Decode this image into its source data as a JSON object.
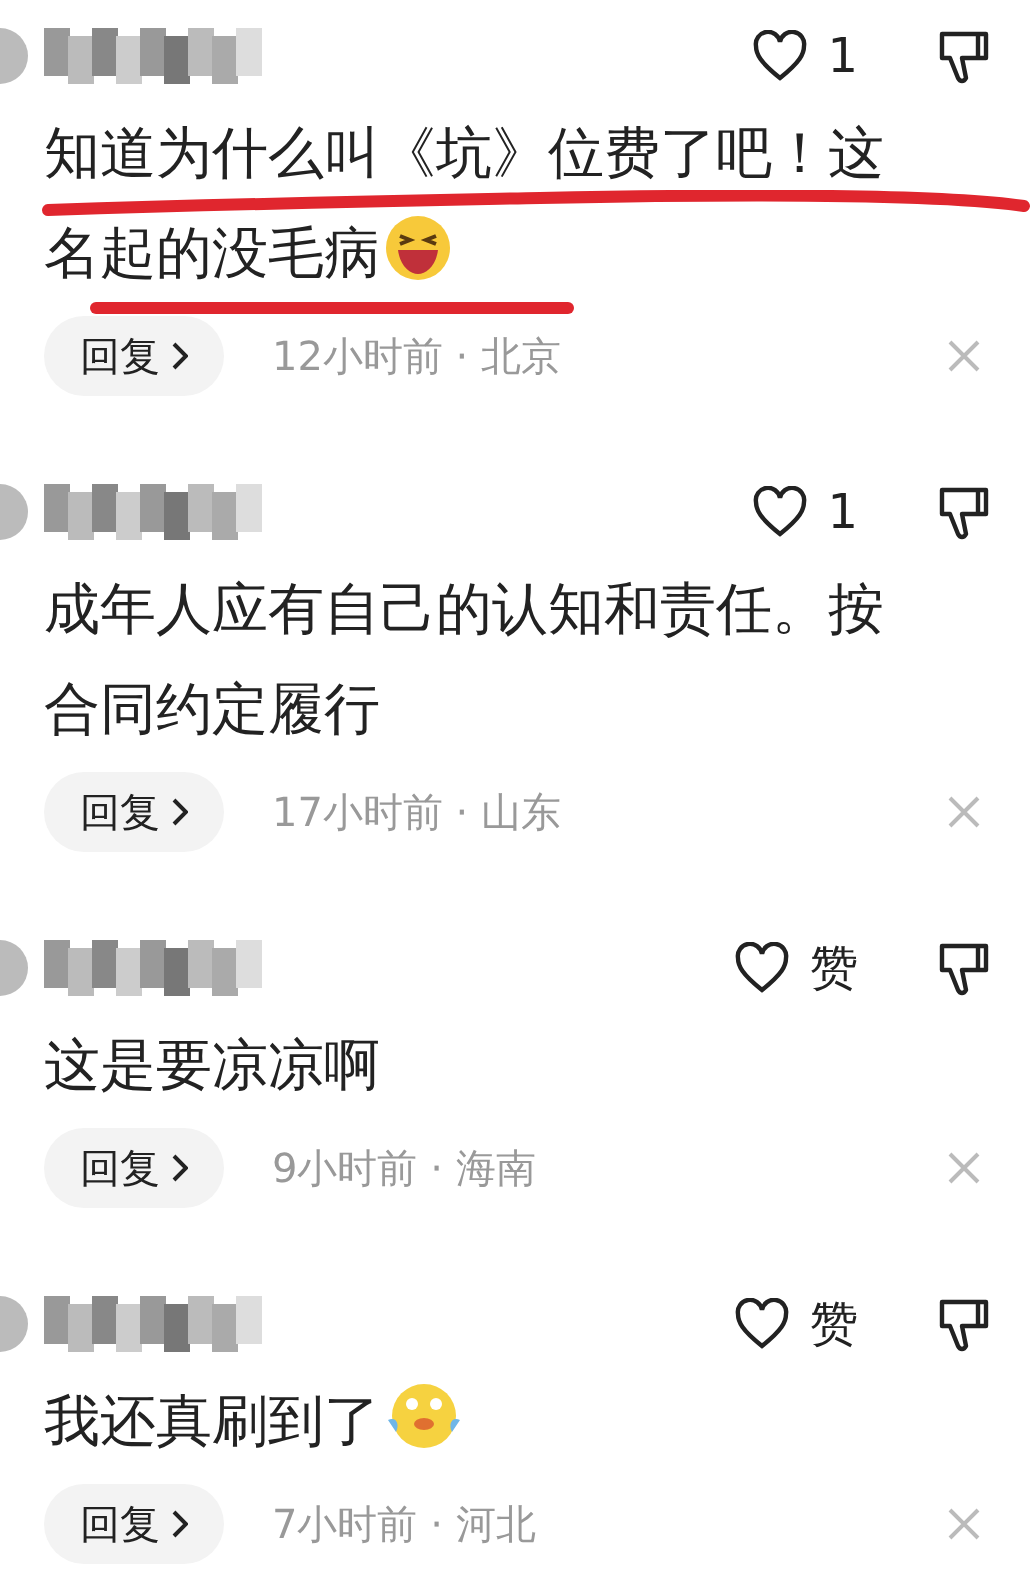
{
  "comments": [
    {
      "likes": "1",
      "text": "知道为什么叫《坑》位费了吧！这名起的没毛病",
      "emoji": {
        "kind": "laughing"
      },
      "underlined": true,
      "reply": "回复",
      "meta": "12小时前 · 北京"
    },
    {
      "likes": "1",
      "text": "成年人应有自己的认知和责任。按合同约定履行",
      "underlined": false,
      "reply": "回复",
      "meta": "17小时前 · 山东"
    },
    {
      "likes": "赞",
      "text": "这是要凉凉啊",
      "underlined": false,
      "reply": "回复",
      "meta": "9小时前 · 海南"
    },
    {
      "likes": "赞",
      "text": "我还真刷到了",
      "emoji": {
        "kind": "crying"
      },
      "underlined": false,
      "reply": "回复",
      "meta": "7小时前 · 河北"
    }
  ]
}
